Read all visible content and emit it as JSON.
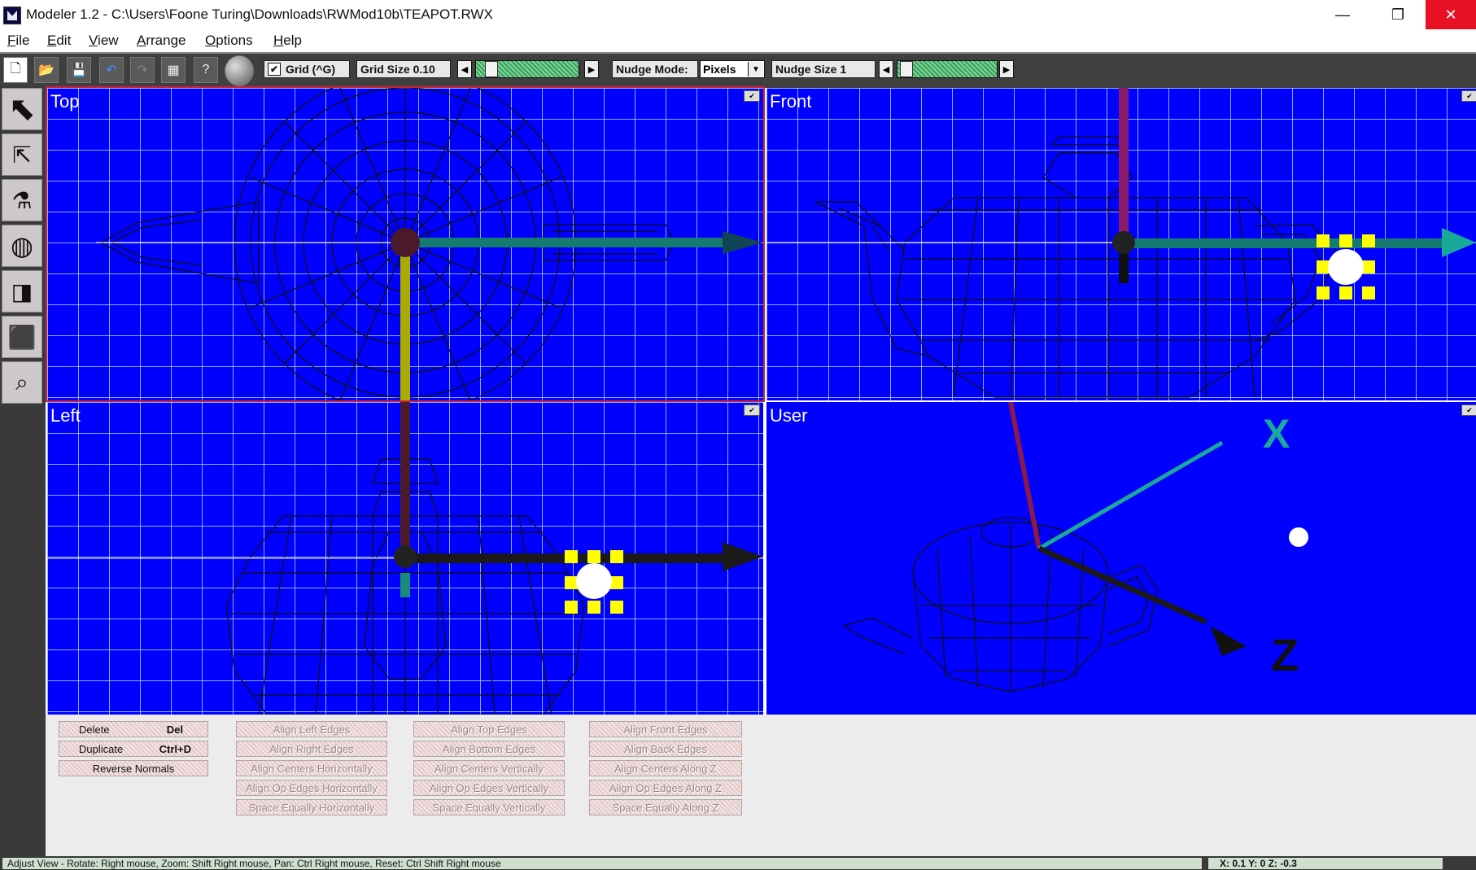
{
  "window": {
    "title": "Modeler 1.2 - C:\\Users\\Foone Turing\\Downloads\\RWMod10b\\TEAPOT.RWX",
    "min_glyph": "—",
    "max_glyph": "❐",
    "close_glyph": "✕"
  },
  "menu": [
    "File",
    "Edit",
    "View",
    "Arrange",
    "Options",
    "Help"
  ],
  "toolbar": {
    "grid_label": "Grid (^G)",
    "grid_checked": true,
    "grid_size_label": "Grid Size 0.10",
    "nudge_mode_label": "Nudge Mode:",
    "nudge_mode_value": "Pixels",
    "nudge_size_label": "Nudge Size 1",
    "icons": [
      "new-file-icon",
      "open-folder-icon",
      "save-icon",
      "undo-icon",
      "redo-icon",
      "grid-props-icon",
      "context-help-icon",
      "sphere-render-icon"
    ]
  },
  "palette": [
    "select-arrow-icon",
    "select-vertex-icon",
    "lamp-light-icon",
    "texture-ball-icon",
    "primitives-icon",
    "box-extrude-icon",
    "lasso-select-icon"
  ],
  "viewports": {
    "top": "Top",
    "front": "Front",
    "left": "Left",
    "user": "User"
  },
  "commands": {
    "delete": {
      "label": "Delete",
      "shortcut": "Del"
    },
    "duplicate": {
      "label": "Duplicate",
      "shortcut": "Ctrl+D"
    },
    "reverse_normals": "Reverse Normals",
    "align_left": "Align Left Edges",
    "align_right": "Align Right Edges",
    "align_centers_h": "Align Centers Horizontally",
    "align_op_h": "Align Op Edges Horizontally",
    "space_h": "Space Equally Horizontally",
    "align_top": "Align Top Edges",
    "align_bottom": "Align Bottom Edges",
    "align_centers_v": "Align Centers Vertically",
    "align_op_v": "Align Op Edges Vertically",
    "space_v": "Space Equally Vertically",
    "align_front": "Align Front Edges",
    "align_back": "Align Back Edges",
    "align_centers_z": "Align Centers Along Z",
    "align_op_z": "Align Op Edges Along Z",
    "space_z": "Space Equally Along Z"
  },
  "status": {
    "hint": "Adjust View - Rotate: Right mouse, Zoom: Shift Right mouse, Pan: Ctrl Right mouse, Reset: Ctrl Shift Right mouse",
    "coords": "X: 0.1  Y: 0  Z: -0.3"
  },
  "colors": {
    "viewport_bg": "#0000ff",
    "axis_x": "#1aa89a",
    "axis_y": "#c020c0",
    "axis_z": "#cccc00",
    "handle": "#ffff00"
  }
}
